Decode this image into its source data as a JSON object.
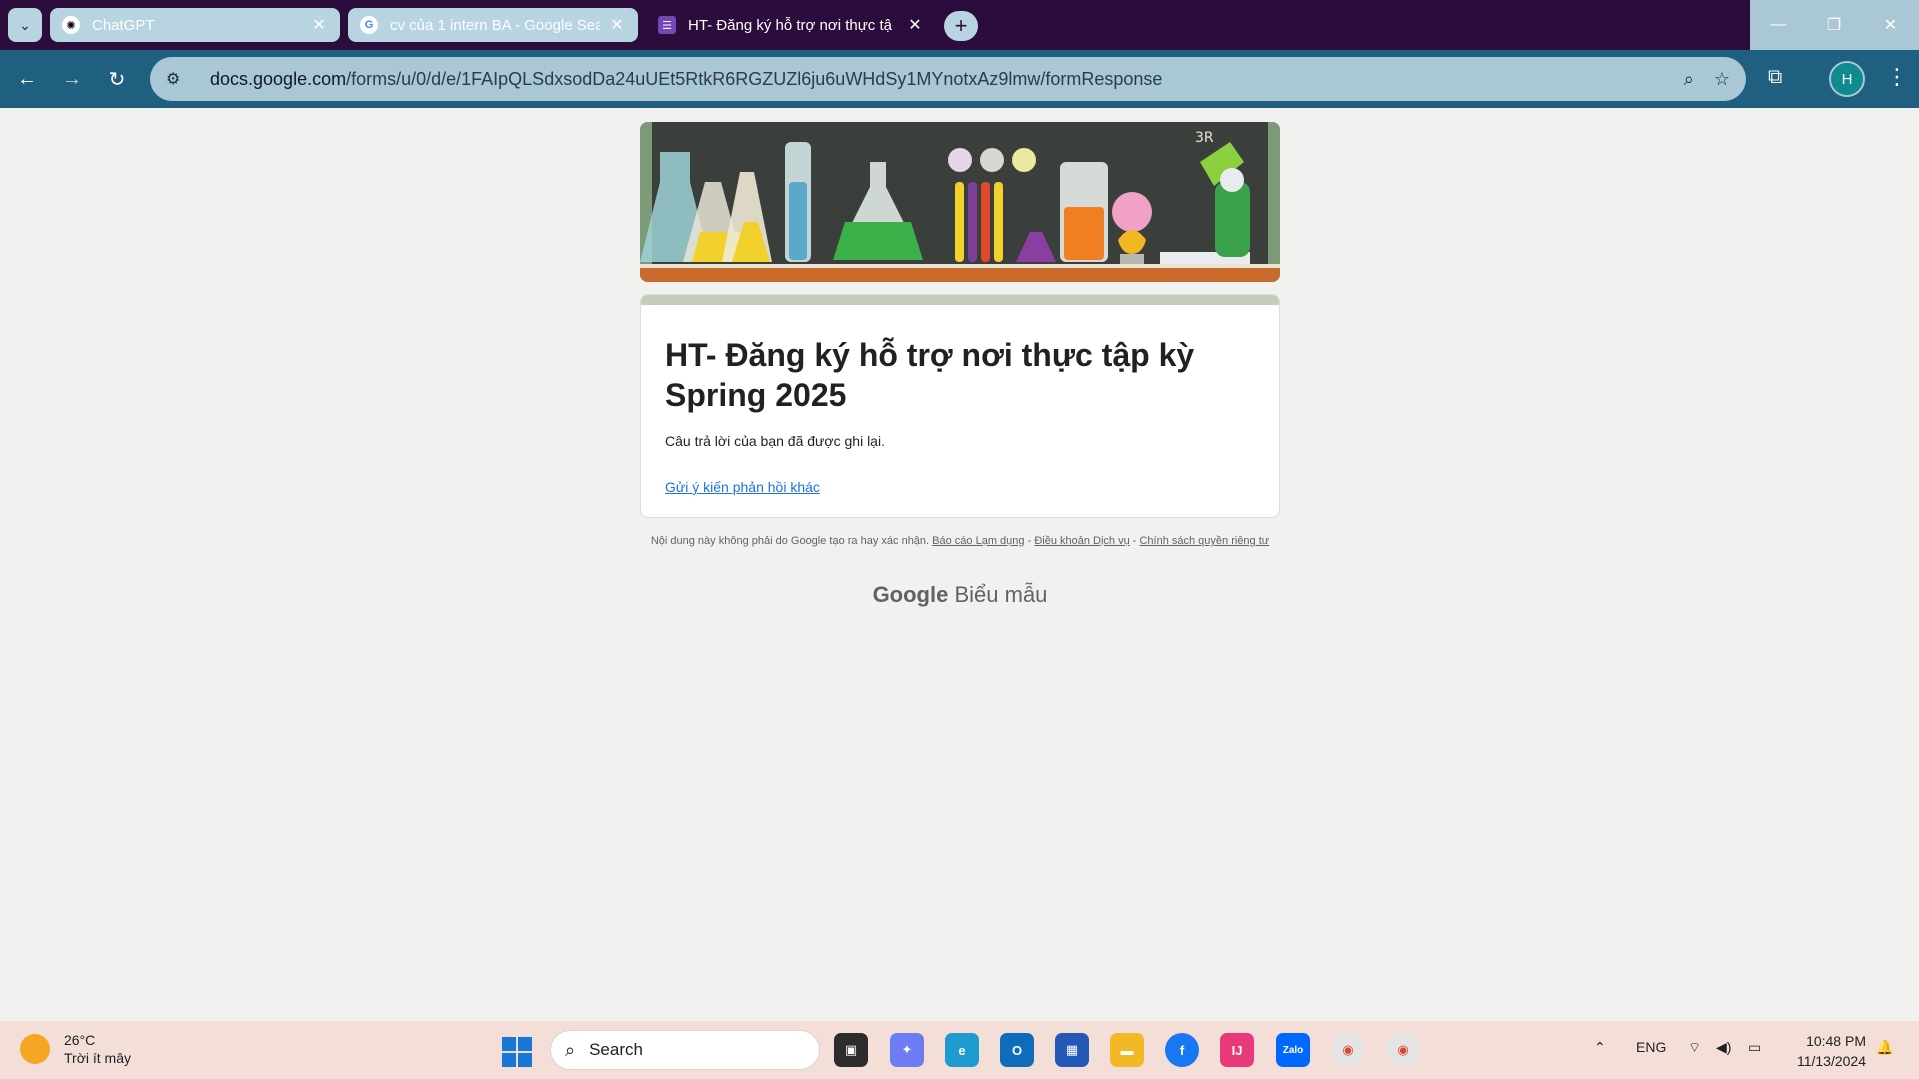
{
  "browser": {
    "tabs": [
      {
        "title": "ChatGPT",
        "active": false
      },
      {
        "title": "cv của 1 intern BA - Google Sea",
        "active": false
      },
      {
        "title": "HT- Đăng ký hỗ trợ nơi thực tậ",
        "active": true
      }
    ],
    "url_host": "docs.google.com",
    "url_path": "/forms/u/0/d/e/1FAIpQLSdxsodDa24uUEt5RtkR6RGZUZl6ju6uWHdSy1MYnotxAz9lmw/formResponse",
    "profile_initial": "H"
  },
  "form": {
    "title": "HT- Đăng ký hỗ trợ nơi thực tập kỳ Spring 2025",
    "confirmation": "Câu trả lời của bạn đã được ghi lại.",
    "resubmit_link": "Gửi ý kiến phản hồi khác",
    "disclaimer_text": "Nội dung này không phải do Google tạo ra hay xác nhận.",
    "report_link": "Báo cáo Lạm dụng",
    "terms_link": "Điều khoản Dịch vụ",
    "privacy_link": "Chính sách quyền riêng tư",
    "brand_google": "Google",
    "brand_forms": "Biểu mẫu"
  },
  "taskbar": {
    "weather_temp": "26°C",
    "weather_desc": "Trời ít mây",
    "search_placeholder": "Search",
    "language": "ENG",
    "time": "10:48 PM",
    "date": "11/13/2024"
  },
  "colors": {
    "tabstrip": "#2b0d3d",
    "toolbar": "#1f5f7f",
    "omnibox": "#a9c7d5",
    "card_accent": "#c3cdb9",
    "link": "#1a73e8"
  }
}
